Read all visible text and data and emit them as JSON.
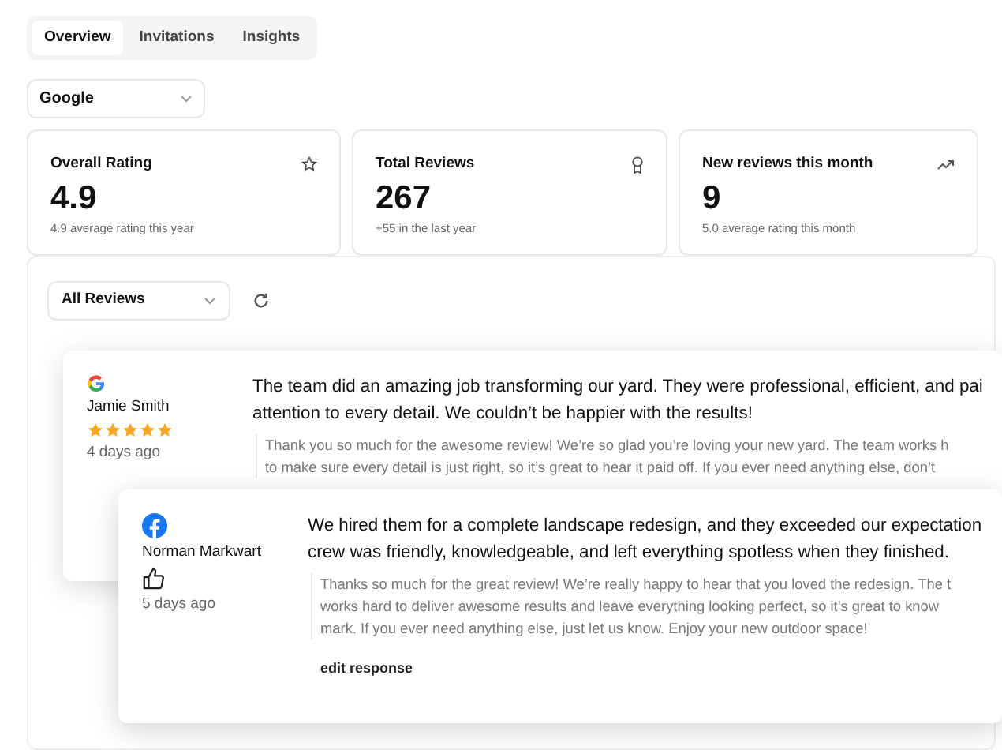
{
  "tabs": [
    {
      "label": "Overview",
      "selected": true
    },
    {
      "label": "Invitations",
      "selected": false
    },
    {
      "label": "Insights",
      "selected": false
    }
  ],
  "source_select": {
    "value": "Google"
  },
  "stats": [
    {
      "title": "Overall Rating",
      "value": "4.9",
      "note": "4.9 average rating this year"
    },
    {
      "title": "Total Reviews",
      "value": "267",
      "note": "+55 in the last year"
    },
    {
      "title": "New reviews this month",
      "value": "9",
      "note": "5.0 average rating this month"
    }
  ],
  "reviews_filter": {
    "value": "All Reviews"
  },
  "reviews": [
    {
      "name": "Jamie Smith",
      "rating": {
        "kind": "stars",
        "stars": 5
      },
      "time": "4 days ago",
      "text": [
        "The team did an amazing job transforming our yard. They were professional, efficient, and pai",
        "attention to every detail. We couldn’t be happier with the results!"
      ],
      "reply": [
        "Thank you so much for the awesome review! We’re so glad you’re loving your new yard. The team works h",
        "to make sure every detail is just right, so it’s great to hear it paid off. If you ever need anything else, don’t"
      ]
    },
    {
      "name": "Norman Markwart",
      "rating": {
        "kind": "recommend"
      },
      "time": "5 days ago",
      "text": [
        "We hired them for a complete landscape redesign, and they exceeded our expectation",
        "crew was friendly, knowledgeable, and left everything spotless when they finished."
      ],
      "reply": [
        "Thanks so much for the great review! We’re really happy to hear that you loved the redesign. The t",
        "works hard to deliver awesome results and leave everything looking perfect, so it’s great to know",
        "mark. If you ever need anything else, just let us know. Enjoy your new outdoor space!"
      ],
      "action": "edit response"
    }
  ]
}
